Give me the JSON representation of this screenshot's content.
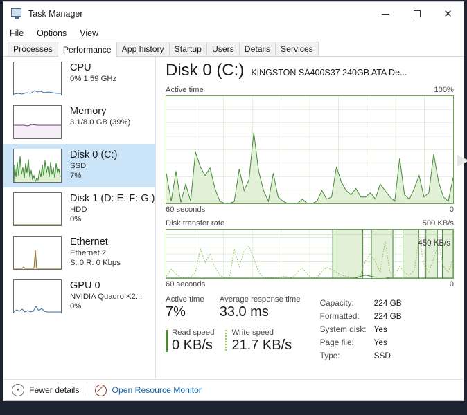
{
  "window": {
    "title": "Task Manager",
    "icon": "task-manager-icon",
    "minimize": "—",
    "maximize": "□",
    "close": "✕"
  },
  "menu": [
    "File",
    "Options",
    "View"
  ],
  "tabs": [
    {
      "label": "Processes",
      "active": false
    },
    {
      "label": "Performance",
      "active": true
    },
    {
      "label": "App history",
      "active": false
    },
    {
      "label": "Startup",
      "active": false
    },
    {
      "label": "Users",
      "active": false
    },
    {
      "label": "Details",
      "active": false
    },
    {
      "label": "Services",
      "active": false
    }
  ],
  "sidebar": {
    "items": [
      {
        "name": "CPU",
        "sub1": "0%  1.59 GHz",
        "sub2": "",
        "selected": false,
        "color": "#3b6fa0"
      },
      {
        "name": "Memory",
        "sub1": "3.1/8.0 GB (39%)",
        "sub2": "",
        "selected": false,
        "color": "#7a3b7a"
      },
      {
        "name": "Disk 0 (C:)",
        "sub1": "SSD",
        "sub2": "7%",
        "selected": true,
        "color": "#3a8c2f"
      },
      {
        "name": "Disk 1 (D: E: F: G:)",
        "sub1": "HDD",
        "sub2": "0%",
        "selected": false,
        "color": "#6a7a2f"
      },
      {
        "name": "Ethernet",
        "sub1": "Ethernet 2",
        "sub2": "S: 0 R: 0 Kbps",
        "selected": false,
        "color": "#8a6a2a"
      },
      {
        "name": "GPU 0",
        "sub1": "NVIDIA Quadro K2...",
        "sub2": "0%",
        "selected": false,
        "color": "#3b6fa0"
      }
    ]
  },
  "main": {
    "title": "Disk 0 (C:)",
    "subtitle": "KINGSTON SA400S37 240GB ATA De...",
    "graphs": [
      {
        "caption": "Active time",
        "max_label": "100%",
        "x_label": "60 seconds",
        "min_label": "0",
        "annotation": ""
      },
      {
        "caption": "Disk transfer rate",
        "max_label": "500 KB/s",
        "x_label": "60 seconds",
        "min_label": "0",
        "annotation": "450 KB/s"
      }
    ],
    "stats": [
      {
        "label": "Active time",
        "value": "7%"
      },
      {
        "label": "Average response time",
        "value": "33.0 ms"
      }
    ],
    "speeds": [
      {
        "label": "Read speed",
        "value": "0 KB/s",
        "marker": "solid"
      },
      {
        "label": "Write speed",
        "value": "21.7 KB/s",
        "marker": "dotted"
      }
    ],
    "properties": [
      {
        "key": "Capacity:",
        "value": "224 GB"
      },
      {
        "key": "Formatted:",
        "value": "224 GB"
      },
      {
        "key": "System disk:",
        "value": "Yes"
      },
      {
        "key": "Page file:",
        "value": "Yes"
      },
      {
        "key": "Type:",
        "value": "SSD"
      }
    ]
  },
  "footer": {
    "fewer_details": "Fewer details",
    "chevron": "∧",
    "resource_monitor": "Open Resource Monitor"
  },
  "colors": {
    "accent_green": "#4a8c3f",
    "fill_green": "#e3f0d8",
    "link_blue": "#1062a8",
    "selection_blue": "#cce4f7"
  },
  "chart_data": [
    {
      "type": "area",
      "title": "Active time",
      "ylabel": "",
      "xlabel": "60 seconds",
      "ylim": [
        0,
        100
      ],
      "grid": true,
      "y_ticks": [
        "100%",
        "0"
      ],
      "values": [
        28,
        2,
        30,
        1,
        18,
        2,
        48,
        34,
        26,
        33,
        14,
        2,
        0,
        0,
        2,
        32,
        12,
        22,
        66,
        30,
        12,
        2,
        28,
        6,
        2,
        0,
        0,
        0,
        4,
        0,
        0,
        2,
        12,
        4,
        6,
        34,
        20,
        12,
        8,
        14,
        6,
        6,
        10,
        4,
        18,
        12,
        6,
        2,
        42,
        8,
        4,
        14,
        26,
        6,
        10,
        46,
        20,
        6,
        2,
        24
      ]
    },
    {
      "type": "line",
      "title": "Disk transfer rate",
      "ylabel": "",
      "xlabel": "60 seconds",
      "ylim": [
        0,
        500
      ],
      "grid": true,
      "y_ticks": [
        "500 KB/s",
        "0"
      ],
      "annotations": [
        {
          "text": "450 KB/s",
          "value": 450
        }
      ],
      "series": [
        {
          "name": "Write speed",
          "values": [
            20,
            90,
            40,
            10,
            5,
            10,
            60,
            300,
            160,
            250,
            120,
            30,
            5,
            5,
            300,
            120,
            280,
            330,
            200,
            60,
            5,
            5,
            5,
            5,
            20,
            10,
            5,
            60,
            100,
            40,
            5,
            5,
            70,
            110,
            90,
            60,
            30,
            20,
            10,
            5,
            40,
            180,
            250,
            170,
            60,
            380,
            60,
            30,
            120,
            60,
            30,
            80,
            420,
            140,
            60,
            200,
            360,
            120,
            60,
            200
          ]
        },
        {
          "name": "Read speed",
          "values": [
            0,
            0,
            0,
            0,
            0,
            0,
            0,
            0,
            0,
            0,
            0,
            0,
            0,
            0,
            0,
            0,
            0,
            0,
            0,
            0,
            0,
            0,
            0,
            0,
            0,
            0,
            0,
            0,
            0,
            0,
            0,
            0,
            0,
            0,
            0,
            0,
            0,
            0,
            0,
            0,
            20,
            30,
            20,
            10,
            10,
            10,
            0,
            0,
            0,
            0,
            0,
            0,
            0,
            0,
            0,
            0,
            0,
            0,
            0,
            0
          ]
        }
      ]
    }
  ]
}
